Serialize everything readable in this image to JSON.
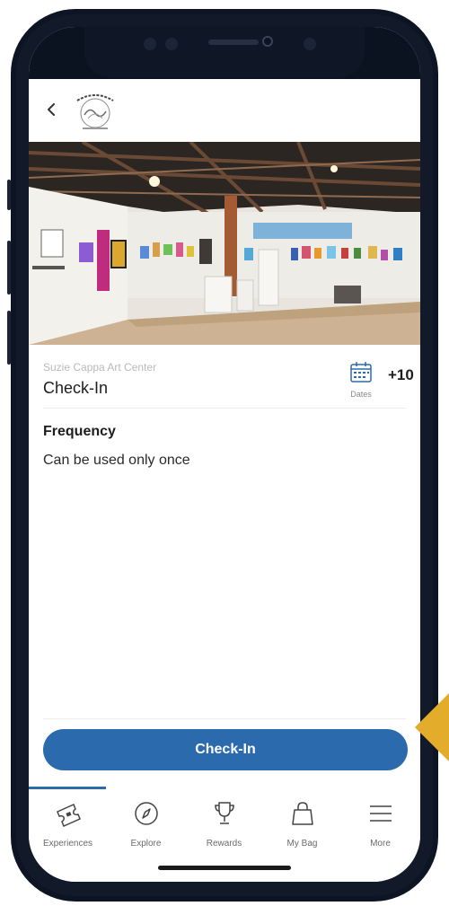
{
  "header": {
    "back_icon": "chevron-left-icon",
    "logo_text": "SOUTH DAKOTA"
  },
  "hero": {
    "description_icon": "gallery-photo"
  },
  "experience": {
    "venue": "Suzie Cappa Art Center",
    "title": "Check-In",
    "dates_label": "Dates",
    "count": "+10"
  },
  "details": {
    "frequency_label": "Frequency",
    "frequency_value": "Can be used only once"
  },
  "cta": {
    "label": "Check-In"
  },
  "tabs": [
    {
      "label": "Experiences",
      "icon": "ticket-icon",
      "active": true
    },
    {
      "label": "Explore",
      "icon": "compass-icon",
      "active": false
    },
    {
      "label": "Rewards",
      "icon": "trophy-icon",
      "active": false
    },
    {
      "label": "My Bag",
      "icon": "bag-icon",
      "active": false
    },
    {
      "label": "More",
      "icon": "menu-icon",
      "active": false
    }
  ],
  "colors": {
    "accent": "#2b6aad",
    "callout": "#e3ac2b"
  }
}
